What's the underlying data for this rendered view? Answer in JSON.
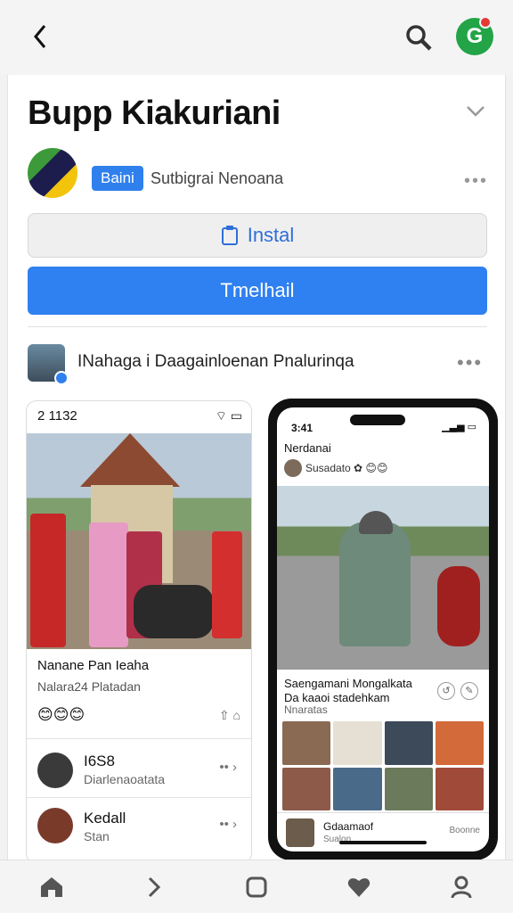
{
  "header": {
    "back_icon": "chevron-left-icon",
    "search_icon": "search-icon",
    "avatar_letter": "G"
  },
  "app": {
    "title": "Bupp Kiakuriani",
    "badge": "Baini",
    "developer": "Sutbigrai Nenoana",
    "install_label": "Instal",
    "primary_label": "Tmelhail",
    "publisher_line": "INahaga i Daagainloenan Pnalurinqa"
  },
  "left_shot": {
    "status_time": "2 1132",
    "status_icons": "⌔ ▭",
    "caption_title": "Nanane Pan Ieaha",
    "caption_sub": "Nalara24 Platadan",
    "reactions": "😊😊😊",
    "row1_title": "I6S8",
    "row1_sub": "Diarlenaoatata",
    "row2_title": "Kedall",
    "row2_sub": "Stan"
  },
  "phone_shot": {
    "time": "3:41",
    "signal": "▁▃▅ ▭",
    "header": "Nerdanai",
    "sub": "Susadato ✿ 😊😊",
    "caption_title": "Saengamani Mongalkata Da kaaoi stadehkam",
    "caption_sub": "Nnaratas",
    "footer_title": "Gdaamaof",
    "footer_sub": "Sualon",
    "footer_right": "Boonne"
  },
  "bottom_nav": [
    "home-icon",
    "forward-icon",
    "square-icon",
    "heart-icon",
    "profile-icon"
  ]
}
